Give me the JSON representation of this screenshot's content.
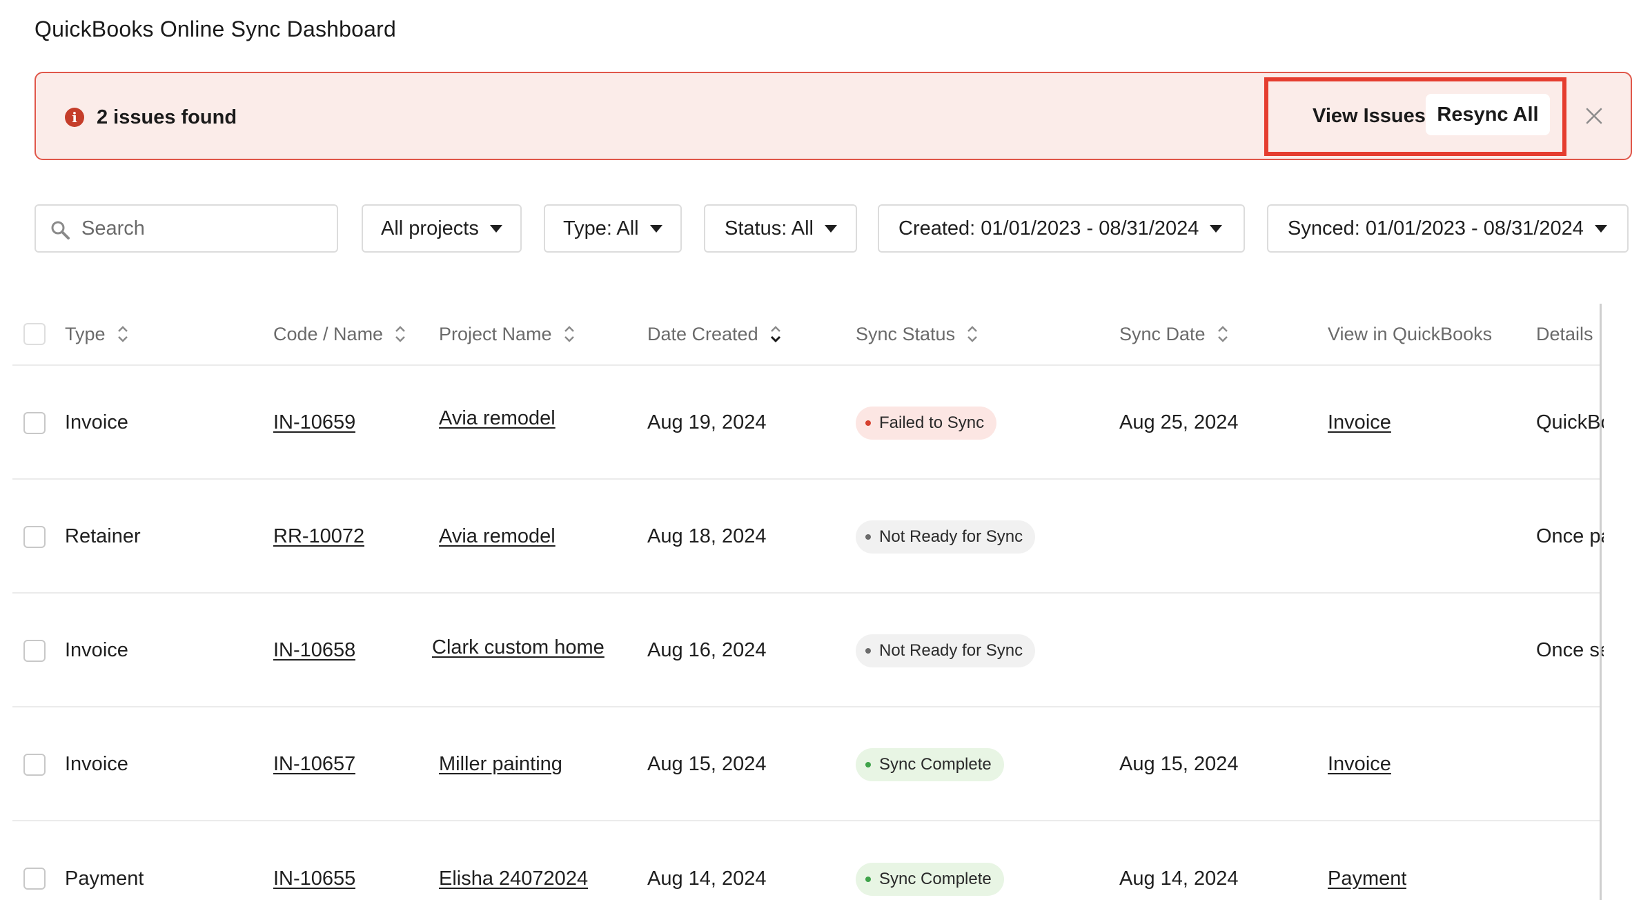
{
  "page": {
    "title": "QuickBooks Online Sync Dashboard"
  },
  "alert": {
    "icon": "info-circle-icon",
    "message": "2 issues found",
    "view_issues_label": "View Issues",
    "resync_all_label": "Resync All",
    "close_icon": "close-icon"
  },
  "filters": {
    "search_placeholder": "Search",
    "projects": "All projects",
    "type": "Type: All",
    "status": "Status: All",
    "created": "Created: 01/01/2023 - 08/31/2024",
    "synced": "Synced: 01/01/2023 - 08/31/2024"
  },
  "table": {
    "headers": {
      "type": "Type",
      "code_name": "Code / Name",
      "project_name": "Project Name",
      "date_created": "Date Created",
      "sync_status": "Sync Status",
      "sync_date": "Sync Date",
      "view_in_qb": "View in QuickBooks",
      "details": "Details"
    },
    "rows": [
      {
        "type": "Invoice",
        "code": "IN-10659",
        "project": "Avia remodel",
        "date_created": "Aug 19, 2024",
        "status": "Failed to Sync",
        "status_kind": "failed",
        "sync_date": "Aug 25, 2024",
        "qb_link": "Invoice",
        "details": "QuickBooks"
      },
      {
        "type": "Retainer",
        "code": "RR-10072",
        "project": "Avia remodel",
        "date_created": "Aug 18, 2024",
        "status": "Not Ready for Sync",
        "status_kind": "notready",
        "sync_date": "",
        "qb_link": "",
        "details": "Once paid"
      },
      {
        "type": "Invoice",
        "code": "IN-10658",
        "project": "Clark custom home",
        "date_created": "Aug 16, 2024",
        "status": "Not Ready for Sync",
        "status_kind": "notready",
        "sync_date": "",
        "qb_link": "",
        "details": "Once sent"
      },
      {
        "type": "Invoice",
        "code": "IN-10657",
        "project": "Miller painting",
        "date_created": "Aug 15, 2024",
        "status": "Sync Complete",
        "status_kind": "complete",
        "sync_date": "Aug 15, 2024",
        "qb_link": "Invoice",
        "details": ""
      },
      {
        "type": "Payment",
        "code": "IN-10655",
        "project": "Elisha 24072024",
        "date_created": "Aug 14, 2024",
        "status": "Sync Complete",
        "status_kind": "complete",
        "sync_date": "Aug 14, 2024",
        "qb_link": "Payment",
        "details": ""
      }
    ]
  },
  "colors": {
    "alert_bg": "#fbece9",
    "alert_border": "#e0574a",
    "highlight_frame": "#e53d2f",
    "failed_dot": "#d6412f",
    "complete_dot": "#3fa34a",
    "notready_dot": "#6b6b6b"
  }
}
